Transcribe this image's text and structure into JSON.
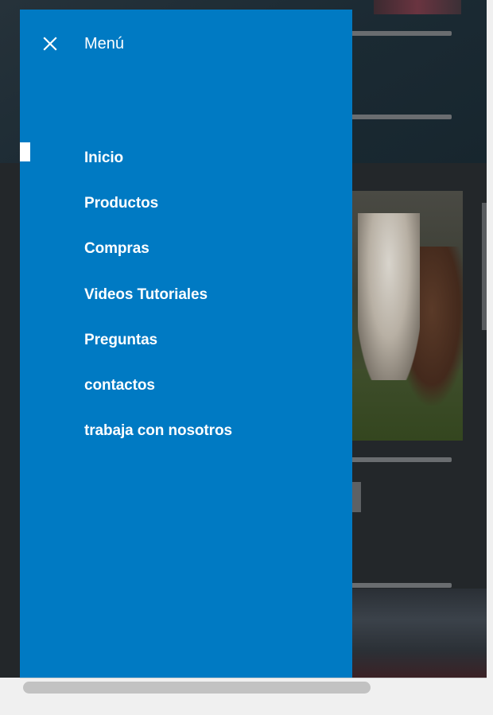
{
  "drawer": {
    "title": "Menú",
    "close_icon": "close-icon",
    "background_color": "#007ac3",
    "items": [
      {
        "label": "Inicio",
        "active": true
      },
      {
        "label": "Productos",
        "active": false
      },
      {
        "label": "Compras",
        "active": false
      },
      {
        "label": "Videos Tutoriales",
        "active": false
      },
      {
        "label": "Preguntas",
        "active": false
      },
      {
        "label": "contactos",
        "active": false
      },
      {
        "label": "trabaja con nosotros",
        "active": false
      }
    ]
  }
}
